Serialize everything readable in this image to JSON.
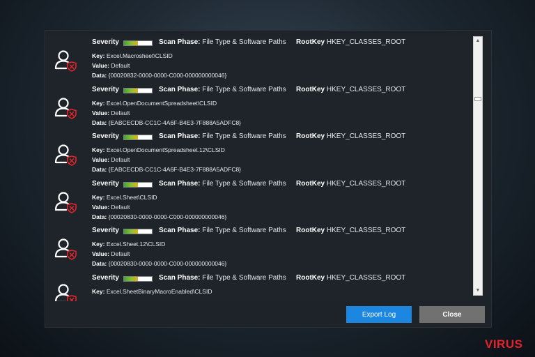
{
  "labels": {
    "severity": "Severity",
    "scan_phase": "Scan Phase:",
    "rootkey": "RootKey",
    "key": "Key:",
    "value": "Value:",
    "data": "Data:"
  },
  "entries": [
    {
      "severity_level": 0.5,
      "scan_phase": "File Type & Software Paths",
      "rootkey": "HKEY_CLASSES_ROOT",
      "key": "Excel.Macrosheet\\CLSID",
      "value": "Default",
      "data": "{00020832-0000-0000-C000-000000000046}"
    },
    {
      "severity_level": 0.5,
      "scan_phase": "File Type & Software Paths",
      "rootkey": "HKEY_CLASSES_ROOT",
      "key": "Excel.OpenDocumentSpreadsheet\\CLSID",
      "value": "Default",
      "data": "{EABCECDB-CC1C-4A6F-B4E3-7F888A5ADFC8}"
    },
    {
      "severity_level": 0.5,
      "scan_phase": "File Type & Software Paths",
      "rootkey": "HKEY_CLASSES_ROOT",
      "key": "Excel.OpenDocumentSpreadsheet.12\\CLSID",
      "value": "Default",
      "data": "{EABCECDB-CC1C-4A6F-B4E3-7F888A5ADFC8}"
    },
    {
      "severity_level": 0.5,
      "scan_phase": "File Type & Software Paths",
      "rootkey": "HKEY_CLASSES_ROOT",
      "key": "Excel.Sheet\\CLSID",
      "value": "Default",
      "data": "{00020830-0000-0000-C000-000000000046}"
    },
    {
      "severity_level": 0.5,
      "scan_phase": "File Type & Software Paths",
      "rootkey": "HKEY_CLASSES_ROOT",
      "key": "Excel.Sheet.12\\CLSID",
      "value": "Default",
      "data": "{00020830-0000-0000-C000-000000000046}"
    },
    {
      "severity_level": 0.5,
      "scan_phase": "File Type & Software Paths",
      "rootkey": "HKEY_CLASSES_ROOT",
      "key": "Excel.SheetBinaryMacroEnabled\\CLSID",
      "value": "",
      "data": ""
    }
  ],
  "buttons": {
    "export": "Export Log",
    "close": "Close"
  },
  "icons": {
    "entry_icon": "user-shield-icon",
    "scroll_up": "arrow-up-icon",
    "scroll_down": "arrow-down-icon"
  },
  "colors": {
    "accent": "#1b87e0",
    "danger": "#e5242a"
  },
  "watermark": "VIRUS"
}
